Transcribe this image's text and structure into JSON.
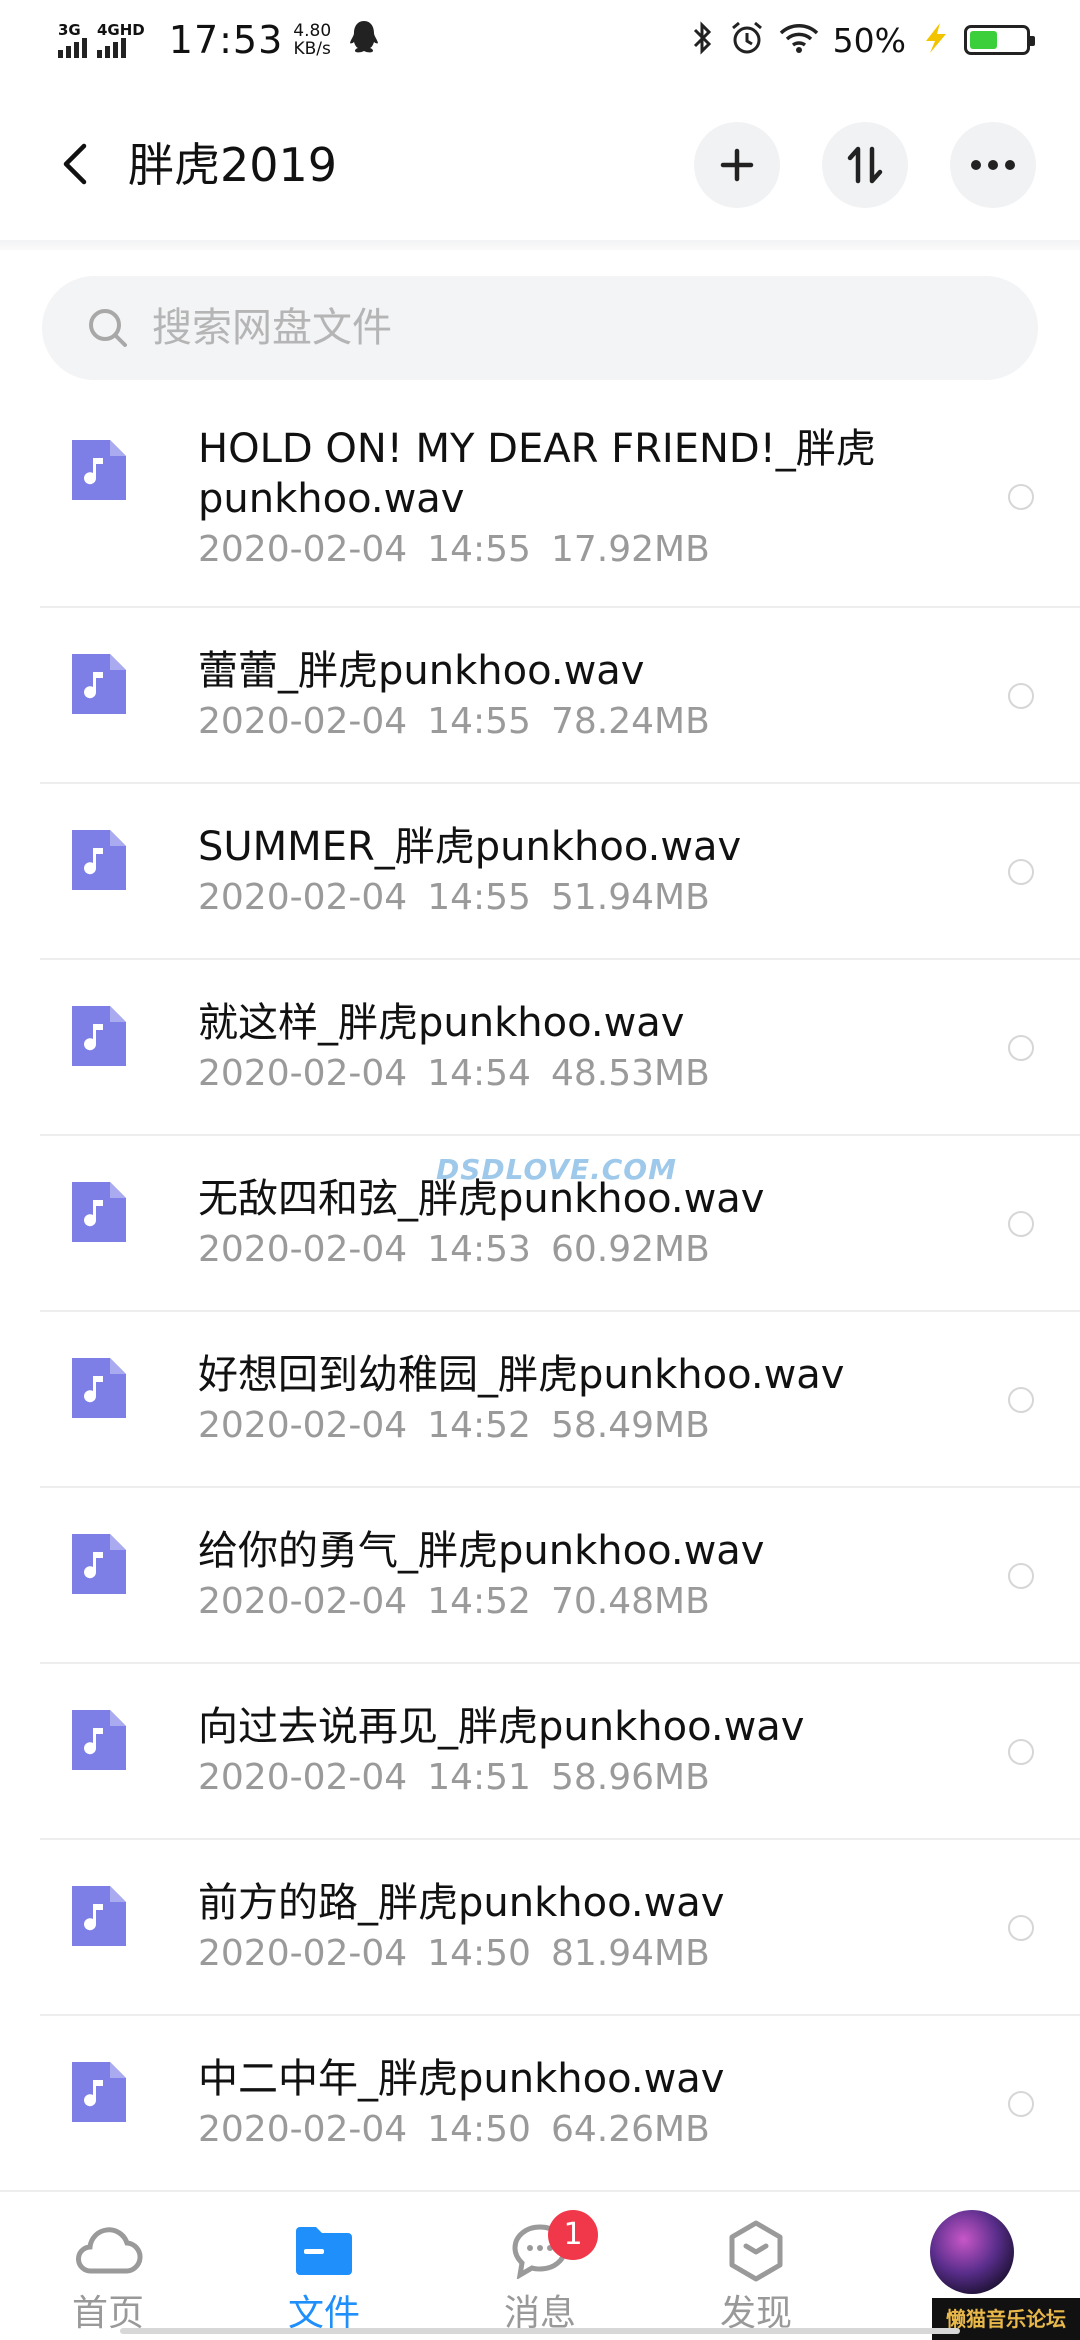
{
  "status_bar": {
    "network1": "3G",
    "network2": "4GHD",
    "time": "17:53",
    "speed_value": "4.80",
    "speed_unit": "KB/s",
    "battery_percent": "50%",
    "battery_level": 0.5,
    "icons": [
      "qq-icon",
      "bluetooth-icon",
      "alarm-icon",
      "wifi-icon",
      "charging-icon",
      "battery-icon"
    ]
  },
  "header": {
    "title": "胖虎2019",
    "buttons": [
      "back-icon",
      "add-icon",
      "sort-icon",
      "more-icon"
    ]
  },
  "search": {
    "placeholder": "搜索网盘文件"
  },
  "files": [
    {
      "name": "HOLD ON! MY DEAR FRIEND!_胖虎punkhoo.wav",
      "date": "2020-02-04",
      "time": "14:55",
      "size": "17.92MB"
    },
    {
      "name": "蕾蕾_胖虎punkhoo.wav",
      "date": "2020-02-04",
      "time": "14:55",
      "size": "78.24MB"
    },
    {
      "name": "SUMMER_胖虎punkhoo.wav",
      "date": "2020-02-04",
      "time": "14:55",
      "size": "51.94MB"
    },
    {
      "name": "就这样_胖虎punkhoo.wav",
      "date": "2020-02-04",
      "time": "14:54",
      "size": "48.53MB"
    },
    {
      "name": "无敌四和弦_胖虎punkhoo.wav",
      "date": "2020-02-04",
      "time": "14:53",
      "size": "60.92MB"
    },
    {
      "name": "好想回到幼稚园_胖虎punkhoo.wav",
      "date": "2020-02-04",
      "time": "14:52",
      "size": "58.49MB"
    },
    {
      "name": "给你的勇气_胖虎punkhoo.wav",
      "date": "2020-02-04",
      "time": "14:52",
      "size": "70.48MB"
    },
    {
      "name": "向过去说再见_胖虎punkhoo.wav",
      "date": "2020-02-04",
      "time": "14:51",
      "size": "58.96MB"
    },
    {
      "name": "前方的路_胖虎punkhoo.wav",
      "date": "2020-02-04",
      "time": "14:50",
      "size": "81.94MB"
    },
    {
      "name": "中二中年_胖虎punkhoo.wav",
      "date": "2020-02-04",
      "time": "14:50",
      "size": "64.26MB"
    }
  ],
  "watermark": "DSDLOVE.COM",
  "bottom_nav": {
    "items": [
      {
        "label": "首页",
        "icon": "cloud-icon",
        "active": false
      },
      {
        "label": "文件",
        "icon": "folder-icon",
        "active": true
      },
      {
        "label": "消息",
        "icon": "chat-icon",
        "active": false,
        "badge": "1"
      },
      {
        "label": "发现",
        "icon": "discover-icon",
        "active": false
      }
    ]
  },
  "forum_tag": "懒猫音乐论坛",
  "colors": {
    "accent": "#1f8ffb",
    "file_icon": "#7d7fe6",
    "badge": "#f0384a",
    "battery": "#3ccf3c",
    "charging": "#f2c400"
  }
}
